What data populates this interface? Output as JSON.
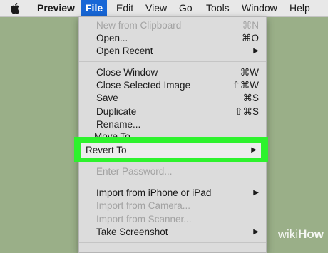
{
  "menubar": {
    "apple_icon": "apple-icon",
    "items": [
      "Preview",
      "File",
      "Edit",
      "View",
      "Go",
      "Tools",
      "Window",
      "Help"
    ],
    "active": "File"
  },
  "file_menu": {
    "items": [
      {
        "label": "New from Clipboard",
        "shortcut": "⌘N",
        "disabled": true
      },
      {
        "label": "Open...",
        "shortcut": "⌘O"
      },
      {
        "label": "Open Recent",
        "shortcut": "▶"
      },
      {
        "label": "Close Window",
        "shortcut": "⌘W"
      },
      {
        "label": "Close Selected Image",
        "shortcut": "⇧⌘W"
      },
      {
        "label": "Save",
        "shortcut": "⌘S"
      },
      {
        "label": "Duplicate",
        "shortcut": "⇧⌘S"
      },
      {
        "label": "Rename..."
      },
      {
        "label": "Move To..."
      },
      {
        "label": "Revert To",
        "shortcut": "▶",
        "highlighted": true
      },
      {
        "label": "Enter Password...",
        "disabled": true
      },
      {
        "label": "Import from iPhone or iPad",
        "shortcut": "▶"
      },
      {
        "label": "Import from Camera...",
        "disabled": true
      },
      {
        "label": "Import from Scanner...",
        "disabled": true
      },
      {
        "label": "Take Screenshot",
        "shortcut": "▶"
      }
    ]
  },
  "watermark": {
    "part1": "wiki",
    "part2": "How"
  },
  "colors": {
    "accent": "#1766d6",
    "highlight": "#2df22d",
    "background": "#9aaf88"
  }
}
